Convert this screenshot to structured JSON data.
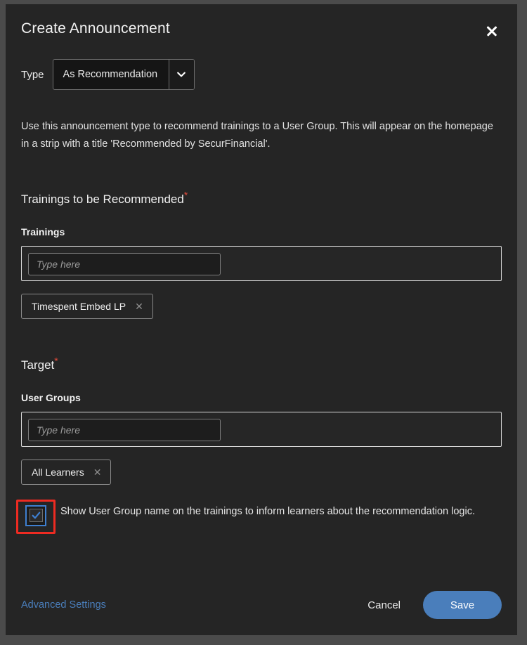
{
  "dialog": {
    "title": "Create Announcement",
    "close_icon": "close-icon"
  },
  "type_field": {
    "label": "Type",
    "selected": "As Recommendation",
    "arrow_icon": "chevron-down-icon"
  },
  "description": "Use this announcement type to recommend trainings to a User Group. This will appear on the homepage in a strip with a title 'Recommended by SecurFinancial'.",
  "trainings_section": {
    "heading": "Trainings to be Recommended",
    "required_marker": "*",
    "field_label": "Trainings",
    "input_placeholder": "Type here",
    "input_value": "",
    "chips": [
      {
        "label": "Timespent Embed LP",
        "remove_icon": "close-icon"
      }
    ]
  },
  "target_section": {
    "heading": "Target",
    "required_marker": "*",
    "field_label": "User Groups",
    "input_placeholder": "Type here",
    "input_value": "",
    "chips": [
      {
        "label": "All Learners",
        "remove_icon": "close-icon"
      }
    ]
  },
  "checkbox_option": {
    "checked": true,
    "check_icon": "checkmark-icon",
    "label": "Show User Group name on the trainings to inform learners about the recommendation logic.",
    "highlight_color": "#ee2b22",
    "accent_color": "#3e7fd0"
  },
  "footer": {
    "advanced_settings_label": "Advanced Settings",
    "cancel_label": "Cancel",
    "save_label": "Save",
    "link_color": "#4a7ebb",
    "save_color": "#4a7ebb"
  }
}
